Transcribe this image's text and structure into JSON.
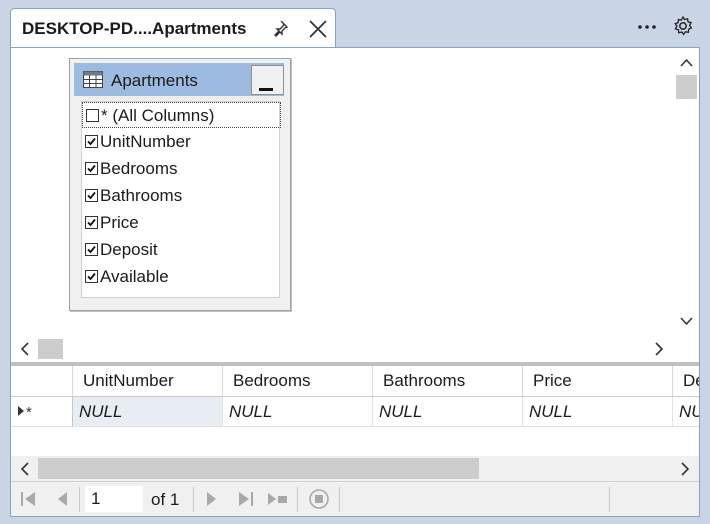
{
  "tab": {
    "title": "DESKTOP-PD....Apartments"
  },
  "table_box": {
    "name": "Apartments",
    "columns": [
      {
        "label": "* (All Columns)",
        "checked": false
      },
      {
        "label": "UnitNumber",
        "checked": true
      },
      {
        "label": "Bedrooms",
        "checked": true
      },
      {
        "label": "Bathrooms",
        "checked": true
      },
      {
        "label": "Price",
        "checked": true
      },
      {
        "label": "Deposit",
        "checked": true
      },
      {
        "label": "Available",
        "checked": true
      }
    ]
  },
  "grid": {
    "headers": [
      "UnitNumber",
      "Bedrooms",
      "Bathrooms",
      "Price",
      "De"
    ],
    "rows": [
      {
        "indicator": "▸*",
        "cells": [
          "NULL",
          "NULL",
          "NULL",
          "NULL",
          "NU"
        ]
      }
    ]
  },
  "navigator": {
    "current_page": "1",
    "of_label": "of 1"
  },
  "icons": {
    "pin": "pin-icon",
    "close": "close-icon",
    "more": "more-icon",
    "settings": "gear-icon",
    "table": "table-grid-icon"
  },
  "colors": {
    "accent": "#9dbbe0",
    "chrome": "#c9d5e5",
    "border": "#8aa2c2"
  }
}
